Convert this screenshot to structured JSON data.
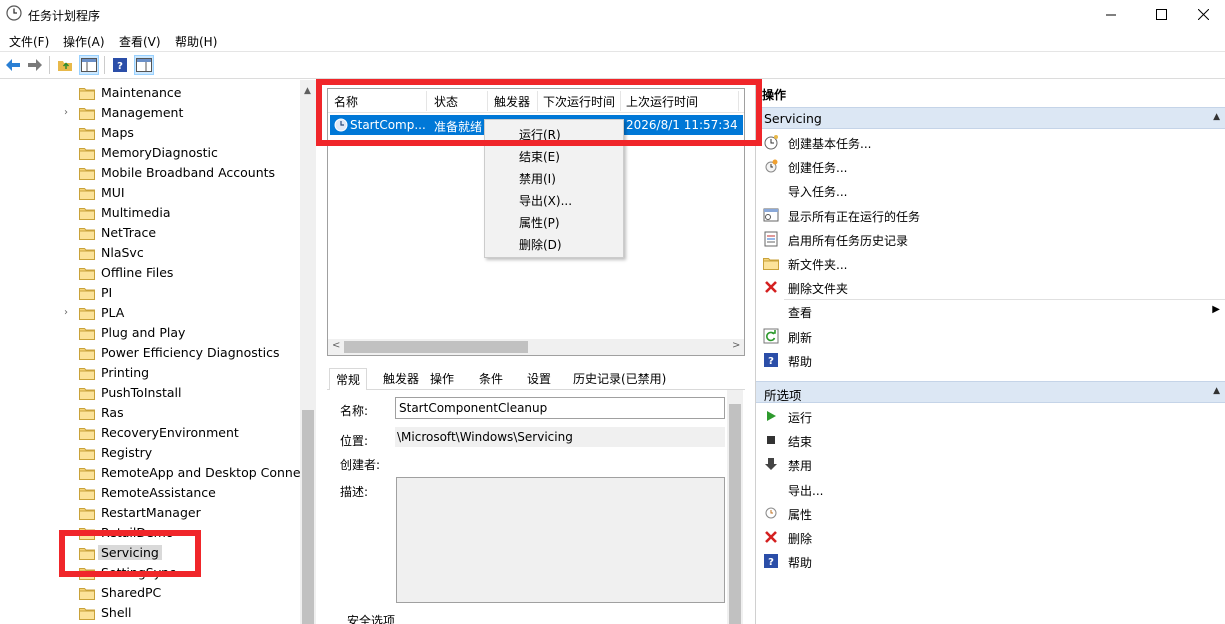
{
  "window": {
    "title": "任务计划程序"
  },
  "menu": [
    "文件(F)",
    "操作(A)",
    "查看(V)",
    "帮助(H)"
  ],
  "tree": {
    "items": [
      {
        "label": "Maintenance",
        "expandable": false
      },
      {
        "label": "Management",
        "expandable": true
      },
      {
        "label": "Maps",
        "expandable": false
      },
      {
        "label": "MemoryDiagnostic",
        "expandable": false
      },
      {
        "label": "Mobile Broadband Accounts",
        "expandable": false
      },
      {
        "label": "MUI",
        "expandable": false
      },
      {
        "label": "Multimedia",
        "expandable": false
      },
      {
        "label": "NetTrace",
        "expandable": false
      },
      {
        "label": "NlaSvc",
        "expandable": false
      },
      {
        "label": "Offline Files",
        "expandable": false
      },
      {
        "label": "PI",
        "expandable": false
      },
      {
        "label": "PLA",
        "expandable": true
      },
      {
        "label": "Plug and Play",
        "expandable": false
      },
      {
        "label": "Power Efficiency Diagnostics",
        "expandable": false
      },
      {
        "label": "Printing",
        "expandable": false
      },
      {
        "label": "PushToInstall",
        "expandable": false
      },
      {
        "label": "Ras",
        "expandable": false
      },
      {
        "label": "RecoveryEnvironment",
        "expandable": false
      },
      {
        "label": "Registry",
        "expandable": false
      },
      {
        "label": "RemoteApp and Desktop Connections",
        "expandable": false
      },
      {
        "label": "RemoteAssistance",
        "expandable": false
      },
      {
        "label": "RestartManager",
        "expandable": false
      },
      {
        "label": "RetailDemo",
        "expandable": false
      },
      {
        "label": "Servicing",
        "expandable": false,
        "selected": true
      },
      {
        "label": "SettingSync",
        "expandable": false
      },
      {
        "label": "SharedPC",
        "expandable": false
      },
      {
        "label": "Shell",
        "expandable": false
      }
    ]
  },
  "tasklist": {
    "columns": [
      "名称",
      "状态",
      "触发器",
      "下次运行时间",
      "上次运行时间"
    ],
    "rows": [
      {
        "name": "StartComp...",
        "status": "准备就绪",
        "triggers": "",
        "next_run": "",
        "last_run": "2026/8/1 11:57:34"
      }
    ]
  },
  "context_menu": [
    "运行(R)",
    "结束(E)",
    "禁用(I)",
    "导出(X)...",
    "属性(P)",
    "删除(D)"
  ],
  "details": {
    "tabs": [
      "常规",
      "触发器",
      "操作",
      "条件",
      "设置",
      "历史记录(已禁用)"
    ],
    "name_label": "名称:",
    "name_value": "StartComponentCleanup",
    "location_label": "位置:",
    "location_value": "\\Microsoft\\Windows\\Servicing",
    "author_label": "创建者:",
    "desc_label": "描述:",
    "security_label": "安全选项"
  },
  "actions": {
    "header": "操作",
    "section1": {
      "title": "Servicing",
      "items": [
        {
          "label": "创建基本任务...",
          "icon": "create-basic-task-icon"
        },
        {
          "label": "创建任务...",
          "icon": "create-task-icon"
        },
        {
          "label": "导入任务...",
          "icon": ""
        },
        {
          "label": "显示所有正在运行的任务",
          "icon": "running-tasks-icon"
        },
        {
          "label": "启用所有任务历史记录",
          "icon": "history-icon"
        },
        {
          "label": "新文件夹...",
          "icon": "folder-icon"
        },
        {
          "label": "删除文件夹",
          "icon": "delete-x-icon"
        },
        {
          "label": "查看",
          "icon": "",
          "submenu": true
        },
        {
          "label": "刷新",
          "icon": "refresh-icon"
        },
        {
          "label": "帮助",
          "icon": "help-icon"
        }
      ]
    },
    "section2": {
      "title": "所选项",
      "items": [
        {
          "label": "运行",
          "icon": "run-icon"
        },
        {
          "label": "结束",
          "icon": "stop-icon"
        },
        {
          "label": "禁用",
          "icon": "disable-icon"
        },
        {
          "label": "导出...",
          "icon": ""
        },
        {
          "label": "属性",
          "icon": "properties-icon"
        },
        {
          "label": "删除",
          "icon": "delete-x-icon"
        },
        {
          "label": "帮助",
          "icon": "help-icon"
        }
      ]
    }
  },
  "colors": {
    "selection": "#0078d7",
    "highlight_box": "#f0262a",
    "section_header": "#dce7f4"
  }
}
